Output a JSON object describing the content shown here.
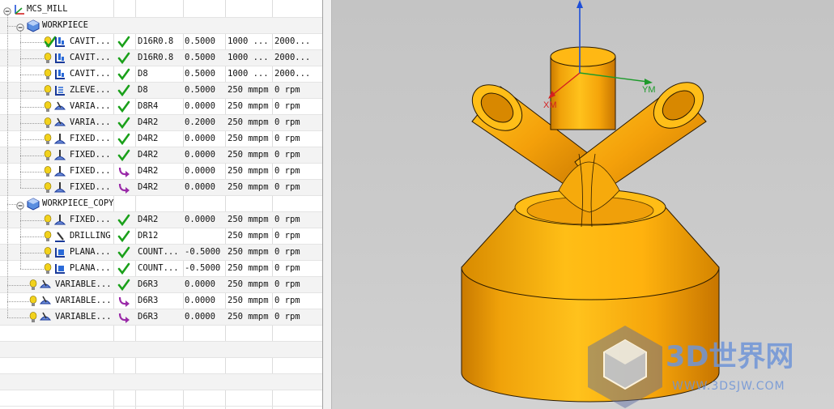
{
  "navigator": {
    "root": {
      "label": "MCS_MILL",
      "icon": "mcs-axes-icon"
    },
    "groups": [
      {
        "label": "WORKPIECE",
        "icon": "workpiece-icon"
      },
      {
        "label": "WORKPIECE_COPY",
        "icon": "workpiece-icon"
      }
    ],
    "operations": [
      {
        "name": "CAVIT...",
        "status": "complete",
        "tool": "D16R0.8",
        "stock": "0.5000",
        "feed": "1000 ...",
        "speed": "2000...",
        "op_icon": "cavity-mill-icon"
      },
      {
        "name": "CAVIT...",
        "status": "complete",
        "tool": "D16R0.8",
        "stock": "0.5000",
        "feed": "1000 ...",
        "speed": "2000...",
        "op_icon": "cavity-mill-icon"
      },
      {
        "name": "CAVIT...",
        "status": "complete",
        "tool": "D8",
        "stock": "0.5000",
        "feed": "1000 ...",
        "speed": "2000...",
        "op_icon": "cavity-mill-icon"
      },
      {
        "name": "ZLEVE...",
        "status": "complete",
        "tool": "D8",
        "stock": "0.5000",
        "feed": "250 mmpm",
        "speed": "0 rpm",
        "op_icon": "zlevel-icon"
      },
      {
        "name": "VARIA...",
        "status": "complete",
        "tool": "D8R4",
        "stock": "0.0000",
        "feed": "250 mmpm",
        "speed": "0 rpm",
        "op_icon": "variable-contour-icon"
      },
      {
        "name": "VARIA...",
        "status": "complete",
        "tool": "D4R2",
        "stock": "0.2000",
        "feed": "250 mmpm",
        "speed": "0 rpm",
        "op_icon": "variable-contour-icon"
      },
      {
        "name": "FIXED...",
        "status": "complete",
        "tool": "D4R2",
        "stock": "0.0000",
        "feed": "250 mmpm",
        "speed": "0 rpm",
        "op_icon": "fixed-contour-icon"
      },
      {
        "name": "FIXED...",
        "status": "complete",
        "tool": "D4R2",
        "stock": "0.0000",
        "feed": "250 mmpm",
        "speed": "0 rpm",
        "op_icon": "fixed-contour-icon"
      },
      {
        "name": "FIXED...",
        "status": "regenerate",
        "tool": "D4R2",
        "stock": "0.0000",
        "feed": "250 mmpm",
        "speed": "0 rpm",
        "op_icon": "fixed-contour-icon"
      },
      {
        "name": "FIXED...",
        "status": "regenerate",
        "tool": "D4R2",
        "stock": "0.0000",
        "feed": "250 mmpm",
        "speed": "0 rpm",
        "op_icon": "fixed-contour-icon"
      },
      {
        "name": "FIXED...",
        "status": "complete",
        "tool": "D4R2",
        "stock": "0.0000",
        "feed": "250 mmpm",
        "speed": "0 rpm",
        "op_icon": "fixed-contour-icon"
      },
      {
        "name": "DRILLING",
        "status": "complete",
        "tool": "DR12",
        "stock": "",
        "feed": "250 mmpm",
        "speed": "0 rpm",
        "op_icon": "drilling-icon"
      },
      {
        "name": "PLANA...",
        "status": "complete",
        "tool": "COUNT...",
        "stock": "-0.5000",
        "feed": "250 mmpm",
        "speed": "0 rpm",
        "op_icon": "planar-mill-icon"
      },
      {
        "name": "PLANA...",
        "status": "complete",
        "tool": "COUNT...",
        "stock": "-0.5000",
        "feed": "250 mmpm",
        "speed": "0 rpm",
        "op_icon": "planar-mill-icon"
      },
      {
        "name": "VARIABLE...",
        "status": "complete",
        "tool": "D6R3",
        "stock": "0.0000",
        "feed": "250 mmpm",
        "speed": "0 rpm",
        "op_icon": "variable-contour-icon"
      },
      {
        "name": "VARIABLE...",
        "status": "regenerate",
        "tool": "D6R3",
        "stock": "0.0000",
        "feed": "250 mmpm",
        "speed": "0 rpm",
        "op_icon": "variable-contour-icon"
      },
      {
        "name": "VARIABLE...",
        "status": "regenerate",
        "tool": "D6R3",
        "stock": "0.0000",
        "feed": "250 mmpm",
        "speed": "0 rpm",
        "op_icon": "variable-contour-icon"
      }
    ]
  },
  "viewport": {
    "axis_labels": {
      "x": "XM",
      "y": "YM"
    },
    "part_color": "#f5a40a",
    "watermark": {
      "title": "3D世界网",
      "url": "WWW.3DSJW.COM"
    }
  },
  "colors": {
    "check": "#1aa01a",
    "regen": "#9a2aa8",
    "bulb": "#f2d21c",
    "axis_z": "#1e4fd8",
    "axis_x": "#d42020",
    "axis_y": "#1c9a2a"
  }
}
